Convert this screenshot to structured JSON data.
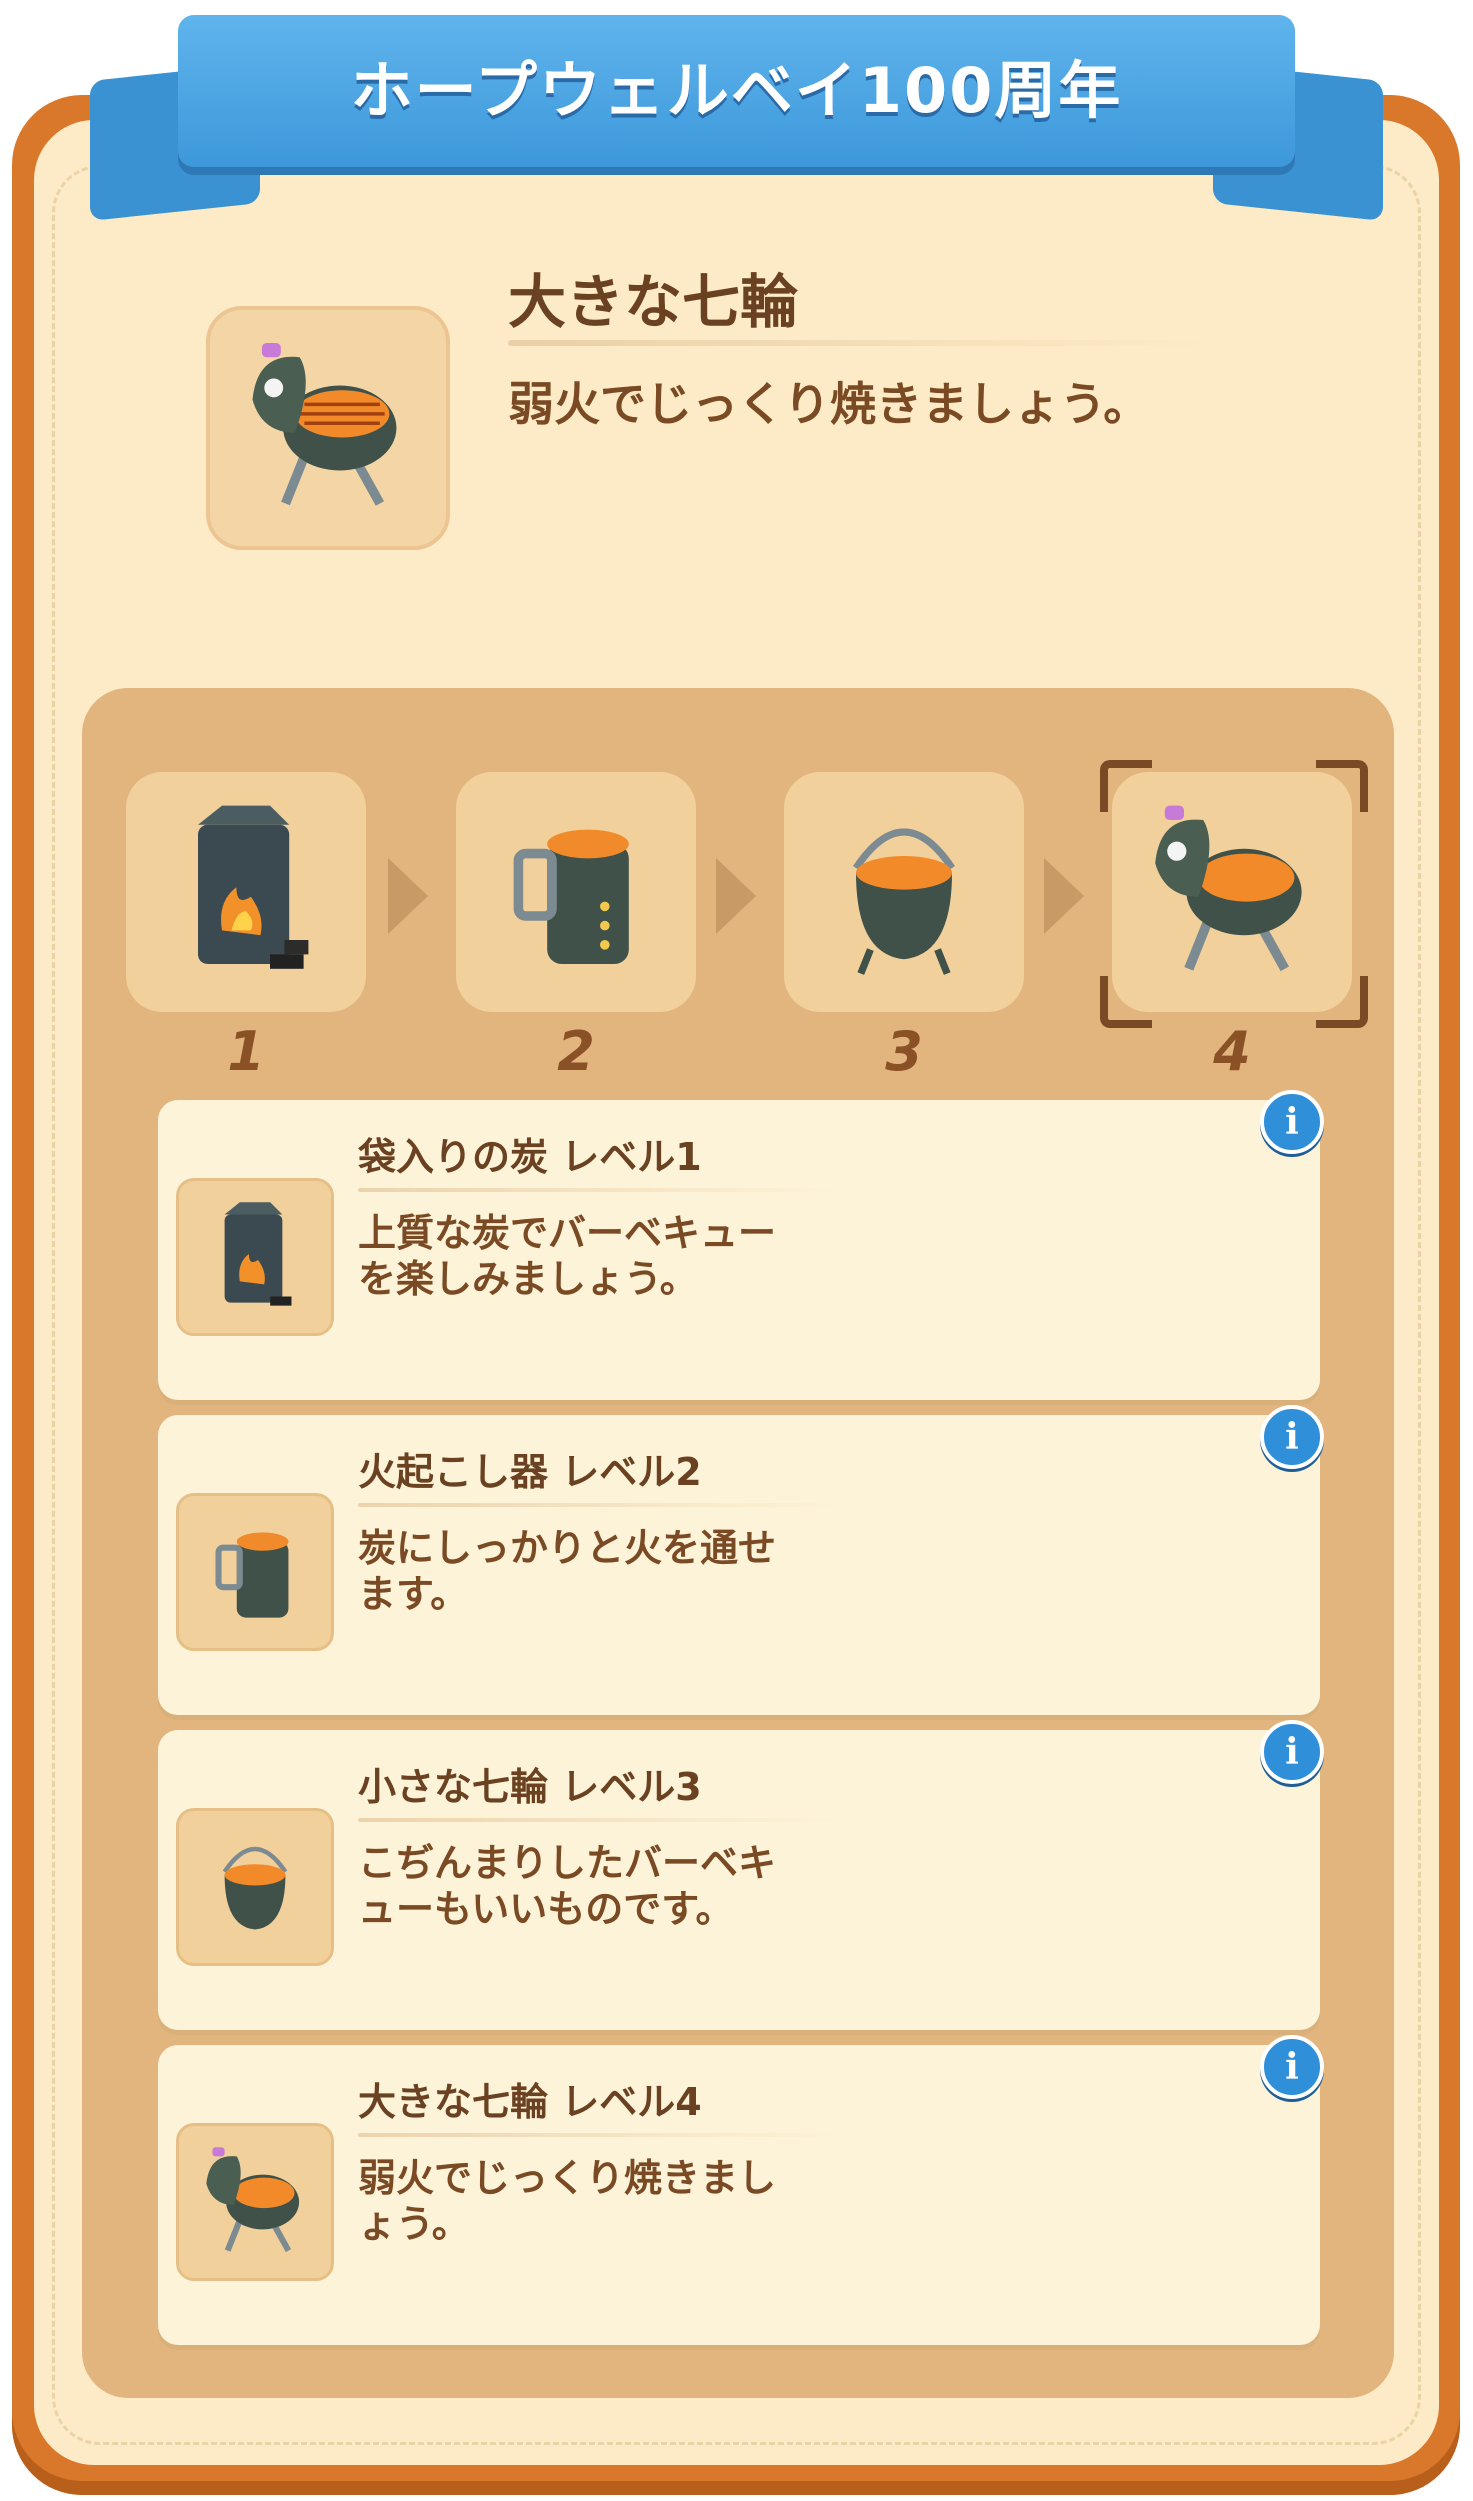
{
  "header": {
    "title": "ホープウェルベイ100周年"
  },
  "item": {
    "name": "大きな七輪",
    "description": "弱火でじっくり焼きましょう。",
    "icon": "large-bbq-grill-icon"
  },
  "progression": {
    "current_step": 4,
    "steps": [
      {
        "number": "1",
        "icon": "charcoal-bag-icon"
      },
      {
        "number": "2",
        "icon": "chimney-starter-icon"
      },
      {
        "number": "3",
        "icon": "small-bbq-grill-icon"
      },
      {
        "number": "4",
        "icon": "large-bbq-grill-icon"
      }
    ]
  },
  "levels": [
    {
      "title": "袋入りの炭 レベル1",
      "description": "上質な炭でバーベキューを楽しみましょう。",
      "icon": "charcoal-bag-icon",
      "info_label": "i"
    },
    {
      "title": "火起こし器 レベル2",
      "description": "炭にしっかりと火を通せます。",
      "icon": "chimney-starter-icon",
      "info_label": "i"
    },
    {
      "title": "小さな七輪 レベル3",
      "description": "こぢんまりしたバーベキューもいいものです。",
      "icon": "small-bbq-grill-icon",
      "info_label": "i"
    },
    {
      "title": "大きな七輪 レベル4",
      "description": "弱火でじっくり焼きましょう。",
      "icon": "large-bbq-grill-icon",
      "info_label": "i"
    }
  ],
  "colors": {
    "frame": "#d9782a",
    "panel": "#fcebc6",
    "ribbon": "#3d98da",
    "text": "#6b4221",
    "info": "#2f8fd8"
  }
}
